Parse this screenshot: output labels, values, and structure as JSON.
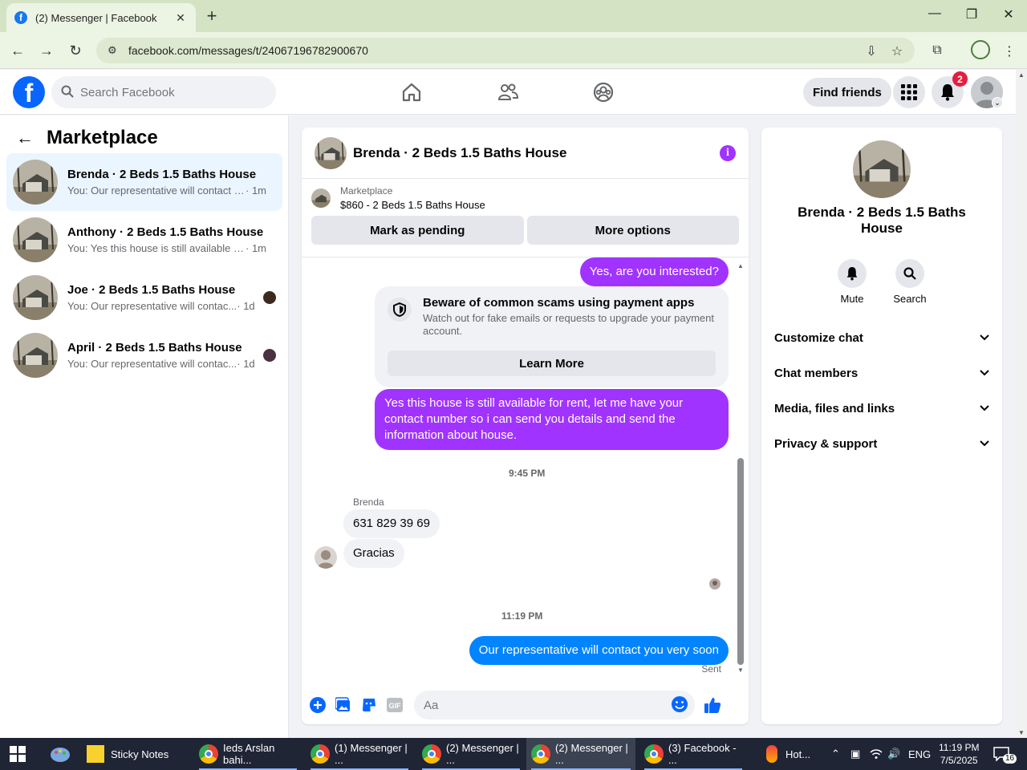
{
  "browser": {
    "tab_title": "(2) Messenger | Facebook",
    "url": "facebook.com/messages/t/24067196782900670"
  },
  "fb": {
    "search_placeholder": "Search Facebook",
    "find_friends": "Find friends",
    "notif_count": "2"
  },
  "left": {
    "title": "Marketplace",
    "conversations": [
      {
        "name": "Brenda · 2 Beds 1.5 Baths House",
        "snippet": "You: Our representative will contact y...",
        "time": "· 1m",
        "active": true
      },
      {
        "name": "Anthony · 2 Beds 1.5 Baths House",
        "snippet": "You: Yes this house is still available fo...",
        "time": "· 1m"
      },
      {
        "name": "Joe · 2 Beds 1.5 Baths House",
        "snippet": "You: Our representative will contac...",
        "time": "· 1d"
      },
      {
        "name": "April · 2 Beds 1.5 Baths House",
        "snippet": "You: Our representative will contac...",
        "time": "· 1d"
      }
    ]
  },
  "chat": {
    "title": "Brenda · 2 Beds 1.5 Baths House",
    "marketplace_label": "Marketplace",
    "listing": "$860 - 2 Beds 1.5 Baths House",
    "mark_pending": "Mark as pending",
    "more_options": "More options",
    "messages": {
      "m1": "Yes, are you interested?",
      "scam_title": "Beware of common scams using payment apps",
      "scam_desc": "Watch out for fake emails or requests to upgrade your payment account.",
      "learn_more": "Learn More",
      "m2": "Yes this house is still available for rent, let me have your contact number so i can send you details and send the information about house.",
      "ts1": "9:45 PM",
      "sender": "Brenda",
      "them1": "631 829 39 69",
      "them2": "Gracias",
      "ts2": "11:19 PM",
      "m3": "Our representative will contact you very soon",
      "status": "Sent"
    },
    "composer_placeholder": "Aa"
  },
  "right": {
    "name": "Brenda · 2 Beds 1.5 Baths House",
    "mute": "Mute",
    "search": "Search",
    "sections": [
      "Customize chat",
      "Chat members",
      "Media, files and links",
      "Privacy & support"
    ]
  },
  "taskbar": {
    "sticky_notes": "Sticky Notes",
    "items": [
      "Ieds Arslan bahi...",
      "(1) Messenger | ...",
      "(2) Messenger | ...",
      "(2) Messenger | ...",
      "(3) Facebook - ..."
    ],
    "weather": "Hot...",
    "lang": "ENG",
    "time": "11:19 PM",
    "date": "7/5/2025",
    "notif": "16"
  }
}
